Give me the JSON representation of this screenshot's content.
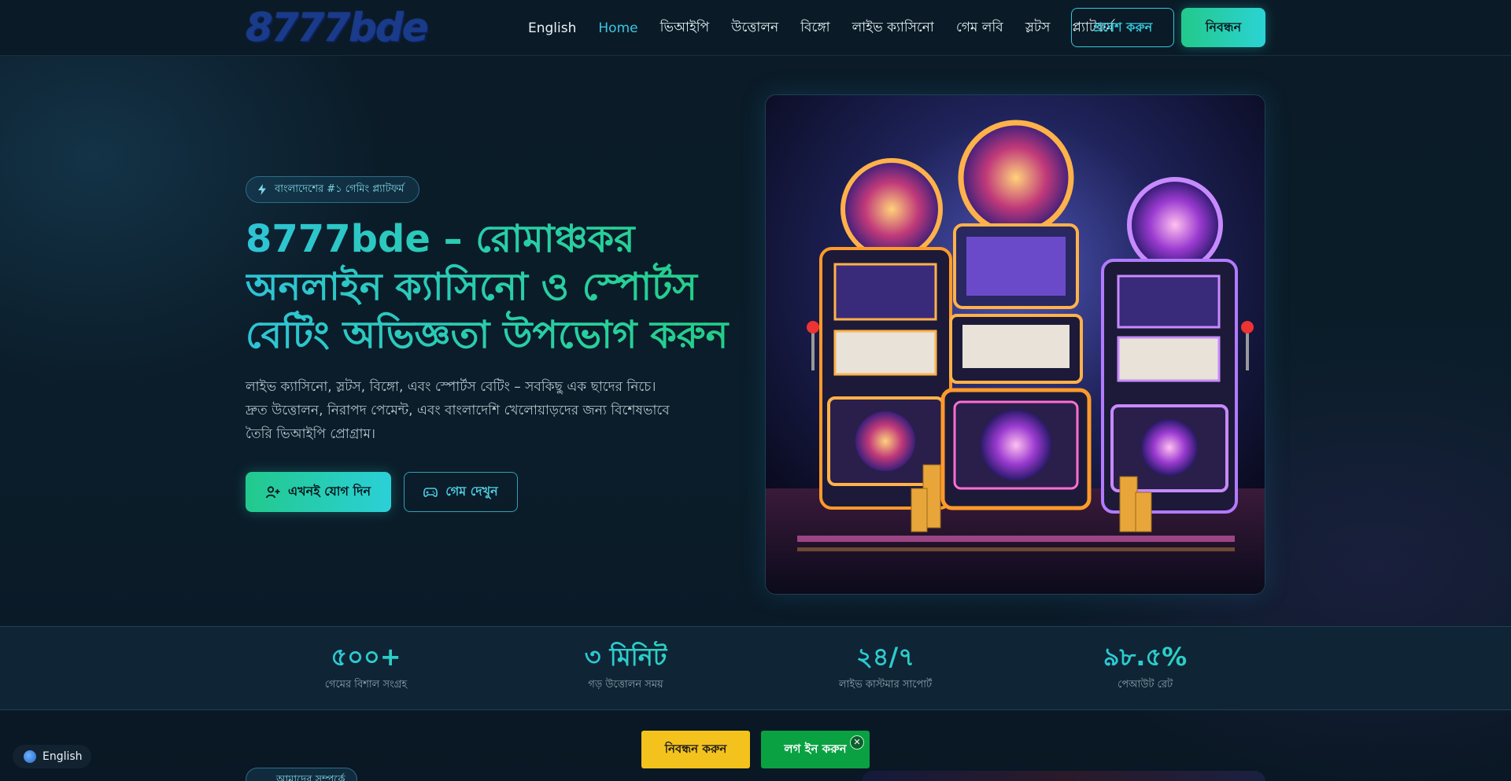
{
  "header": {
    "logo_text": "8777bde",
    "nav": [
      {
        "label": "English",
        "active": false
      },
      {
        "label": "Home",
        "active": true
      },
      {
        "label": "ভিআইপি",
        "active": false
      },
      {
        "label": "উত্তোলন",
        "active": false
      },
      {
        "label": "বিঙ্গো",
        "active": false
      },
      {
        "label": "লাইভ ক্যাসিনো",
        "active": false
      },
      {
        "label": "গেম লবি",
        "active": false
      },
      {
        "label": "স্লটস",
        "active": false
      },
      {
        "label": "প্ল্যাটফর্ম",
        "active": false
      }
    ],
    "login_label": "প্রবেশ করুন",
    "register_label": "নিবন্ধন"
  },
  "hero": {
    "badge_icon": "bolt-icon",
    "badge_text": "বাংলাদেশের #১ গেমিং প্ল্যাটফর্ম",
    "title": "8777bde – রোমাঞ্চকর অনলাইন ক্যাসিনো ও স্পোর্টস বেটিং অভিজ্ঞতা উপভোগ করুন",
    "description": "লাইভ ক্যাসিনো, স্লটস, বিঙ্গো, এবং স্পোর্টস বেটিং – সবকিছু এক ছাদের নিচে। দ্রুত উত্তোলন, নিরাপদ পেমেন্ট, এবং বাংলাদেশি খেলোয়াড়দের জন্য বিশেষভাবে তৈরি ভিআইপি প্রোগ্রাম।",
    "join_label": "এখনই যোগ দিন",
    "join_icon": "user-plus-icon",
    "games_label": "গেম দেখুন",
    "games_icon": "gamepad-icon",
    "image_desc": "slot-machines-illustration"
  },
  "stats": [
    {
      "value": "৫০০+",
      "label": "গেমের বিশাল সংগ্রহ"
    },
    {
      "value": "৩ মিনিট",
      "label": "গড় উত্তোলন সময়"
    },
    {
      "value": "২৪/৭",
      "label": "লাইভ কাস্টমার সাপোর্ট"
    },
    {
      "value": "৯৮.৫%",
      "label": "পেআউট রেট"
    }
  ],
  "next_section": {
    "badge_text": "আমাদের সম্পর্কে"
  },
  "language_switch": {
    "label": "English"
  },
  "sticky_bar": {
    "register_label": "নিবন্ধন করুন",
    "login_label": "লগ ইন করুন",
    "close_symbol": "✕"
  },
  "colors": {
    "background": "#0a1a26",
    "accent_cyan": "#36c6d9",
    "accent_green": "#23c98a",
    "sticky_yellow": "#f4c21d",
    "sticky_green": "#0aa143"
  }
}
